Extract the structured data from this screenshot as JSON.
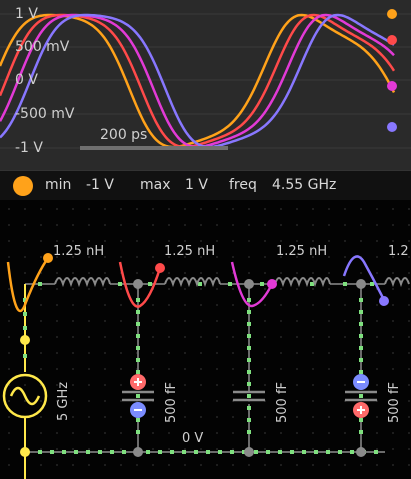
{
  "scope": {
    "y_labels": [
      "1 V",
      "500 mV",
      "0 V",
      "-500 mV",
      "-1 V"
    ],
    "time_scale": "200 ps",
    "trace_colors": [
      "#ffa21a",
      "#ff4a4a",
      "#e23ad6",
      "#8877ff"
    ]
  },
  "info": {
    "min_label": "min",
    "min_value": "-1 V",
    "max_label": "max",
    "max_value": "1 V",
    "freq_label": "freq",
    "freq_value": "4.55 GHz",
    "dot_color": "#ffa21a"
  },
  "circuit": {
    "inductor_labels": [
      "1.25 nH",
      "1.25 nH",
      "1.25 nH",
      "1.2"
    ],
    "source_freq": "5 GHz",
    "cap_labels": [
      "500 fF",
      "500 fF",
      "500 fF"
    ],
    "ground_label": "0 V"
  }
}
